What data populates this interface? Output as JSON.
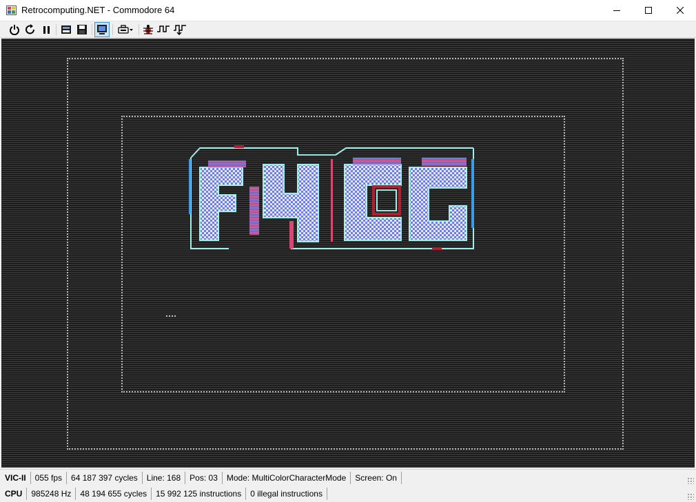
{
  "window": {
    "title": "Retrocomputing.NET - Commodore 64",
    "icon": "app-icon",
    "controls": [
      "minimize-icon",
      "maximize-icon",
      "close-icon"
    ]
  },
  "toolbar": {
    "buttons": [
      {
        "name": "power-button",
        "icon": "power-icon",
        "active": false
      },
      {
        "name": "reset-button",
        "icon": "reset-icon",
        "active": false
      },
      {
        "name": "pause-button",
        "icon": "pause-icon",
        "active": false
      },
      {
        "name": "load-state-button",
        "icon": "film-icon",
        "active": false
      },
      {
        "name": "save-state-button",
        "icon": "floppy-icon",
        "active": false
      },
      {
        "name": "monitor-button",
        "icon": "monitor-icon",
        "active": true
      },
      {
        "name": "cartridge-dropdown-button",
        "icon": "cartridge-icon",
        "active": false
      },
      {
        "name": "debug-button",
        "icon": "bug-icon",
        "active": false
      },
      {
        "name": "step-button",
        "icon": "step-signal-icon",
        "active": false
      },
      {
        "name": "step-into-button",
        "icon": "step-into-signal-icon",
        "active": false
      }
    ]
  },
  "emulator_screen": {
    "border_color": "#2b2b2b",
    "logo_colors": [
      "#d44a74",
      "#6c7de8",
      "#e8e8e8",
      "#9ff0e8",
      "#3a9be8",
      "#b02030",
      "#ffffff"
    ]
  },
  "status_vic": {
    "label": "VIC-II",
    "fps": "055 fps",
    "cycles": "64 187 397 cycles",
    "line": "Line: 168",
    "pos": "Pos: 03",
    "mode": "Mode: MultiColorCharacterMode",
    "screen": "Screen: On"
  },
  "status_cpu": {
    "label": "CPU",
    "frequency": "985248 Hz",
    "cycles": "48 194 655 cycles",
    "instructions": "15 992 125 instructions",
    "illegal": "0 illegal instructions"
  }
}
